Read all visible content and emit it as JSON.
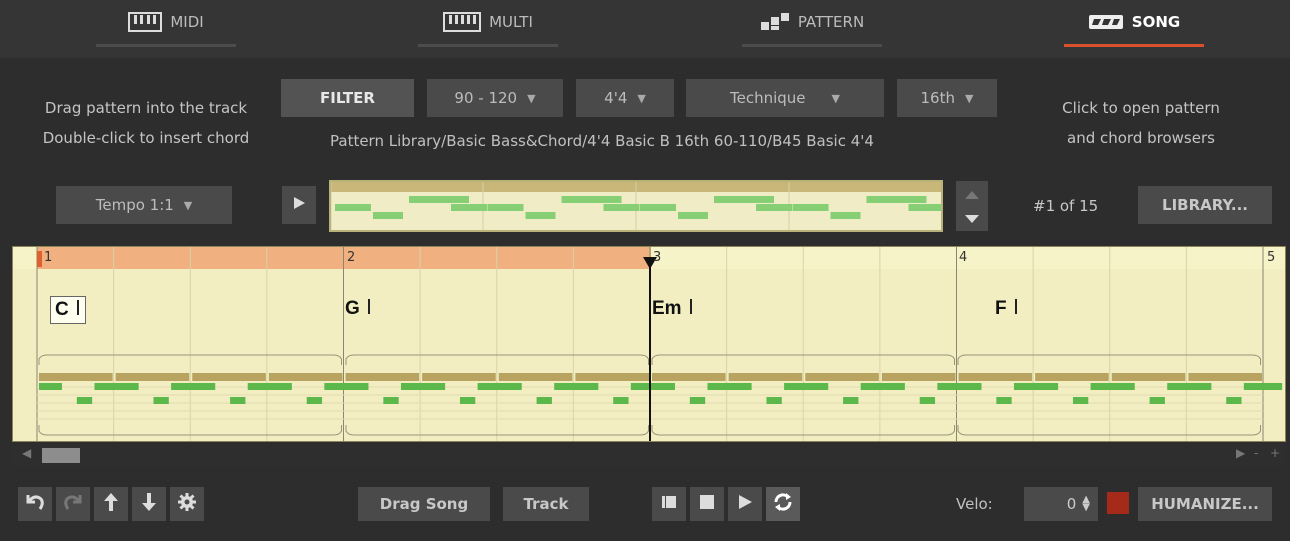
{
  "tabs": [
    {
      "label": "MIDI",
      "icon": "piano-keys-icon",
      "active": false
    },
    {
      "label": "MULTI",
      "icon": "piano-keys-icon",
      "active": false
    },
    {
      "label": "PATTERN",
      "icon": "pattern-blocks-icon",
      "active": false
    },
    {
      "label": "SONG",
      "icon": "song-blocks-icon",
      "active": true
    }
  ],
  "hints": {
    "left_line1": "Drag pattern into the track",
    "left_line2": "Double-click to insert chord",
    "right_line1": "Click to open pattern",
    "right_line2": "and chord browsers"
  },
  "filter": {
    "button": "FILTER",
    "tempo_range": "90 - 120",
    "time_signature": "4'4",
    "technique": "Technique",
    "division": "16th"
  },
  "pattern_path": "Pattern Library/Basic Bass&Chord/4'4 Basic B 16th 60-110/B45 Basic 4'4",
  "tempo_select": "Tempo 1:1",
  "pattern_counter": "#1 of 15",
  "library_button": "LIBRARY...",
  "arranger": {
    "bar_numbers": [
      "1",
      "2",
      "3",
      "4",
      "5"
    ],
    "chords": [
      "C",
      "G",
      "Em",
      "F"
    ]
  },
  "toolbar": {
    "drag_song": "Drag Song",
    "track": "Track",
    "velo_label": "Velo:",
    "velo_value": "0",
    "humanize": "HUMANIZE..."
  },
  "colors": {
    "background": "#2d2d2d",
    "accent": "#d9502c",
    "track_bg": "#f2eec2",
    "note_green": "#5cb84a",
    "chord_bar": "#b8a460",
    "playhead_region": "#f0b080"
  }
}
